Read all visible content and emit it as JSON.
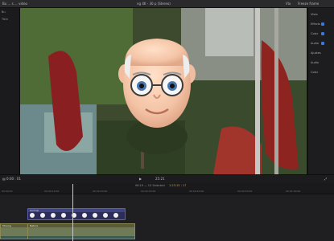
{
  "app": {
    "left_label": "Bu ... s ... video",
    "center_label": "ng 4K - 30 p (Stereo)",
    "right_items": [
      "Vlo",
      "Freeze frame"
    ]
  },
  "left_strip": {
    "items": [
      "Bu",
      "Titre"
    ]
  },
  "inspector": {
    "rows": [
      "Vista",
      "Effects",
      "Color",
      "Audio",
      "Ajustes",
      "Audio",
      "Color"
    ],
    "accent_color": "#3a78e0"
  },
  "controls": {
    "left": "▤ 0:00 : 01",
    "center": "▶",
    "timecode": "25:21",
    "right": "⤢"
  },
  "timeline_header": {
    "project": "06:19 — 10 Selected",
    "selection": "1:23:15 : 17"
  },
  "ruler_ticks": [
    "00:00:00",
    "00:00:10:00",
    "00:00:20:00",
    "00:00:30:00",
    "00:00:40:00",
    "00:00:50:00",
    "00:01:00:00"
  ],
  "clips": {
    "top_label": "Animoji",
    "top_thumb_count": 9,
    "main_label": "Moving",
    "main_label_2": "Nature"
  },
  "icons": {
    "play": "play-icon",
    "fullscreen": "fullscreen-icon"
  }
}
